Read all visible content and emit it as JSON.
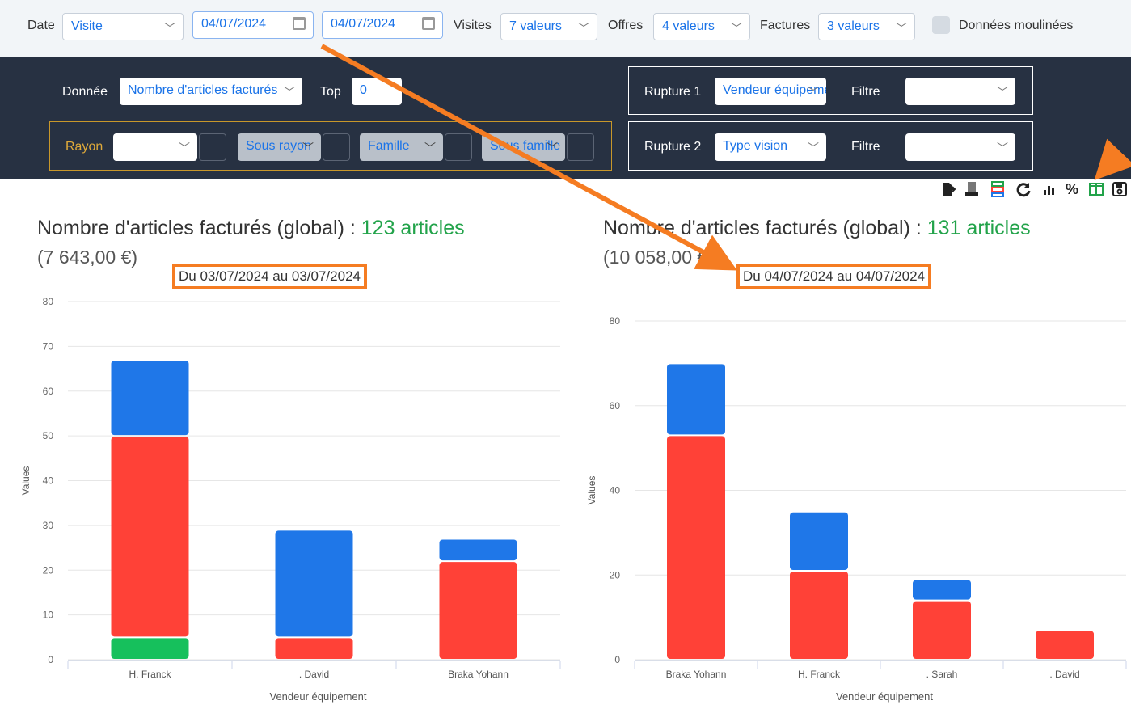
{
  "topbar": {
    "date_label": "Date",
    "date_type": "Visite",
    "date_from": "04/07/2024",
    "date_to": "04/07/2024",
    "visites_label": "Visites",
    "visites_value": "7 valeurs",
    "offres_label": "Offres",
    "offres_value": "4 valeurs",
    "factures_label": "Factures",
    "factures_value": "3 valeurs",
    "moulinees_label": "Données moulinées"
  },
  "panel": {
    "donnee_label": "Donnée",
    "donnee_value": "Nombre d'articles facturés",
    "top_label": "Top",
    "top_value": "0",
    "rayon_label": "Rayon",
    "rayon_value": "",
    "sous_rayon_value": "Sous rayon",
    "famille_value": "Famille",
    "sous_famille_value": "Sous famille",
    "rupture1_label": "Rupture 1",
    "rupture1_value": "Vendeur équipement",
    "rupture2_label": "Rupture 2",
    "rupture2_value": "Type vision",
    "filtre_label": "Filtre",
    "filtre1_value": "",
    "filtre2_value": ""
  },
  "toolbar_icons": [
    "export-icon",
    "price-icon",
    "stack-icon",
    "refresh-icon",
    "bar-chart-icon",
    "percent-icon",
    "split-view-icon",
    "save-icon"
  ],
  "left": {
    "title": "Nombre d'articles facturés (global) : ",
    "count": "123 articles",
    "amount": "(7 643,00 €)",
    "period": "Du 03/07/2024 au 03/07/2024"
  },
  "right": {
    "title": "Nombre d'articles facturés (global) : ",
    "count": "131 articles",
    "amount": "(10 058,00 €)",
    "period": "Du 04/07/2024 au 04/07/2024"
  },
  "colors": {
    "blue": "#1f77e8",
    "red": "#ff4137",
    "green": "#16c05c",
    "accent": "#f57c22"
  },
  "chart_data": [
    {
      "type": "bar",
      "stacked": true,
      "categories": [
        "H. Franck",
        ". David",
        "Braka Yohann"
      ],
      "series": [
        {
          "color": "#16c05c",
          "values": [
            5,
            0,
            0
          ]
        },
        {
          "color": "#ff4137",
          "values": [
            45,
            5,
            22
          ]
        },
        {
          "color": "#1f77e8",
          "values": [
            17,
            24,
            5
          ]
        }
      ],
      "xlabel": "Vendeur équipement",
      "ylabel": "Values",
      "ylim": [
        0,
        80
      ],
      "yticks": [
        0,
        10,
        20,
        30,
        40,
        50,
        60,
        70,
        80
      ],
      "grid": true
    },
    {
      "type": "bar",
      "stacked": true,
      "categories": [
        "Braka Yohann",
        "H. Franck",
        ". Sarah",
        ". David"
      ],
      "series": [
        {
          "color": "#ff4137",
          "values": [
            53,
            21,
            14,
            7
          ]
        },
        {
          "color": "#1f77e8",
          "values": [
            17,
            14,
            5,
            0
          ]
        }
      ],
      "xlabel": "Vendeur équipement",
      "ylabel": "Values",
      "ylim": [
        0,
        80
      ],
      "yticks": [
        0,
        20,
        40,
        60,
        80
      ],
      "grid": true
    }
  ]
}
